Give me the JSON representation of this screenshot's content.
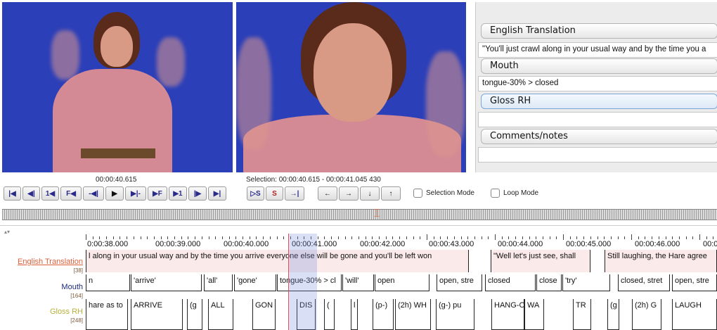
{
  "player": {
    "video_time": "00:00:40.615",
    "selection_text": "Selection: 00:00:40.615 - 00:00:41.045  430"
  },
  "tier_panel": {
    "tiers": [
      {
        "name": "English Translation",
        "value": "\"You'll just crawl along in your usual way and by the time you a"
      },
      {
        "name": "Mouth",
        "value": "tongue-30% > closed"
      },
      {
        "name": "Gloss RH",
        "value": ""
      },
      {
        "name": "Comments/notes",
        "value": ""
      }
    ]
  },
  "controls": {
    "buttons": [
      "|◀",
      "◀|",
      "1◀",
      "F◀",
      "-◀|",
      "▶",
      "▶|-",
      "▶F",
      "▶1",
      "|▶",
      "▶|"
    ],
    "selection_buttons": [
      "▷S",
      "S",
      "→|"
    ],
    "arrows": [
      "←",
      "→",
      "↓",
      "↑"
    ],
    "selection_mode_label": "Selection Mode",
    "loop_mode_label": "Loop Mode"
  },
  "ruler": {
    "labels": [
      "0:00:38.000",
      "00:00:39.000",
      "00:00:40.000",
      "00:00:41.000",
      "00:00:42.000",
      "00:00:43.000",
      "00:00:44.000",
      "00:00:45.000",
      "00:00:46.000",
      "00:00"
    ]
  },
  "tiers": {
    "english": {
      "name": "English Translation",
      "count": "[38]",
      "color": "#d9603a",
      "annotations": [
        "l along in your usual way and by the time you arrive everyone else will be gone and you'll be left won",
        "\"Well let's just see, shall",
        "Still laughing, the Hare agree"
      ]
    },
    "mouth": {
      "name": "Mouth",
      "count": "[164]",
      "color": "#1a2a7a",
      "annotations": [
        "n",
        "'arrive'",
        "'all'",
        "'gone'",
        "tongue-30% > cl",
        "'will'",
        "open",
        "open, stre",
        "closed",
        "close",
        "'try'",
        "closed, stret",
        "open, stre"
      ]
    },
    "gloss": {
      "name": "Gloss RH",
      "count": "[248]",
      "color": "#b8b03a",
      "annotations": [
        "hare as to",
        "ARRIVE",
        "(g",
        "ALL",
        "GON",
        "DIS",
        "(",
        "l",
        "(p-)",
        "(2h) WH",
        "(g-) pu",
        "HANG-O",
        "WA",
        "TR",
        "(g",
        "(2h) G",
        "LAUGH"
      ]
    }
  }
}
